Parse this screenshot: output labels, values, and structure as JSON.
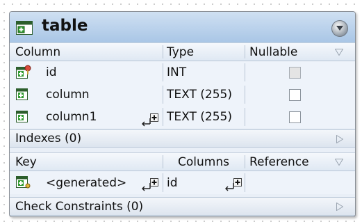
{
  "table": {
    "title": "table",
    "columns_header": {
      "column": "Column",
      "type": "Type",
      "nullable": "Nullable"
    },
    "columns": [
      {
        "name": "id",
        "type": "INT",
        "nullable": false,
        "nullable_disabled": true,
        "icon": "primary-key-column-icon"
      },
      {
        "name": "column",
        "type": "TEXT (255)",
        "nullable": false,
        "nullable_disabled": false,
        "icon": "column-icon"
      },
      {
        "name": "column1",
        "type": "TEXT (255)",
        "nullable": false,
        "nullable_disabled": false,
        "icon": "column-icon"
      }
    ],
    "indexes_section": "Indexes (0)",
    "keys_header": {
      "key": "Key",
      "columns": "Columns",
      "reference": "Reference"
    },
    "keys": [
      {
        "key": "<generated>",
        "columns": "id",
        "icon": "key-icon"
      }
    ],
    "check_constraints_section": "Check Constraints (0)"
  },
  "colors": {
    "title_bar_top": "#cfe0f2",
    "title_bar_bottom": "#a9c6e6",
    "row_background": "#eef3fa",
    "icon_green": "#2f9a2f"
  }
}
